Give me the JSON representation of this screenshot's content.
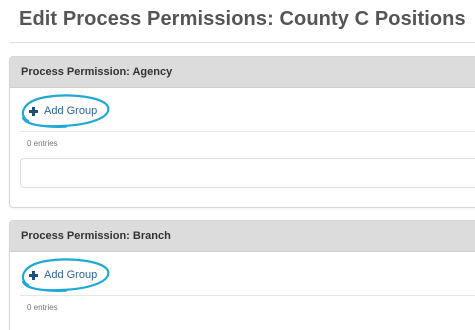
{
  "page": {
    "title": "Edit Process Permissions: County C Positions"
  },
  "panels": [
    {
      "title": "Process Permission: Agency",
      "add_label": "Add Group",
      "entries_text": "0 entries"
    },
    {
      "title": "Process Permission: Branch",
      "add_label": "Add Group",
      "entries_text": "0 entries"
    }
  ],
  "colors": {
    "accent": "#2a6496",
    "highlight_circle": "#1fa9d6",
    "panel_header": "#dcdcdc"
  }
}
